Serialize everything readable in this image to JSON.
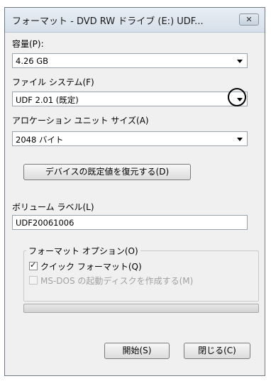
{
  "window": {
    "title": "フォーマット - DVD RW ドライブ (E:) UDF...",
    "close_label": "✕"
  },
  "capacity": {
    "label": "容量(P):",
    "value": "4.26 GB"
  },
  "filesystem": {
    "label": "ファイル システム(F)",
    "value": "UDF 2.01 (既定)"
  },
  "allocation": {
    "label": "アロケーション ユニット サイズ(A)",
    "value": "2048 バイト"
  },
  "restore_button": "デバイスの既定値を復元する(D)",
  "volume": {
    "label": "ボリューム ラベル(L)",
    "value": "UDF20061006"
  },
  "format_options": {
    "legend": "フォーマット オプション(O)",
    "quick_format": {
      "label": "クイック フォーマット(Q)",
      "checked": true
    },
    "msdos_startup": {
      "label": "MS-DOS の起動ディスクを作成する(M)",
      "checked": false,
      "enabled": false
    }
  },
  "progress": {
    "value": 0
  },
  "buttons": {
    "start": "開始(S)",
    "close": "閉じる(C)"
  }
}
